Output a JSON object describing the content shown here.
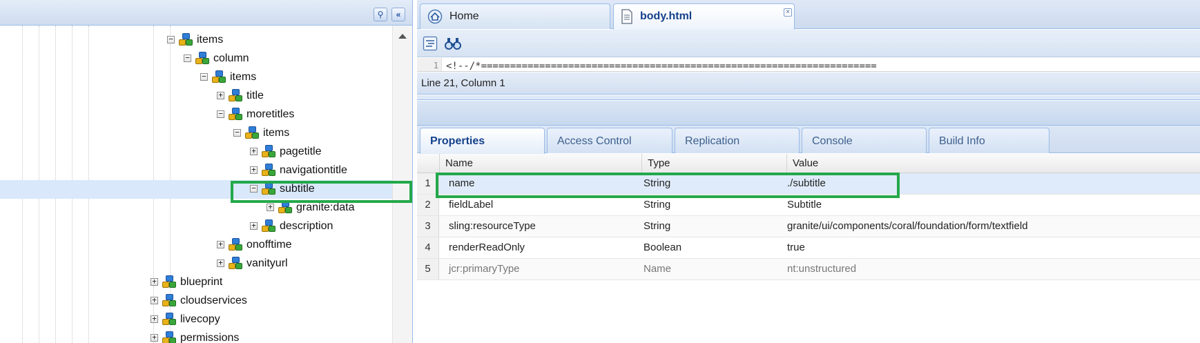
{
  "tree": {
    "rows": [
      {
        "label": "items",
        "toggle": "−"
      },
      {
        "label": "column",
        "toggle": "−"
      },
      {
        "label": "items",
        "toggle": "−"
      },
      {
        "label": "title",
        "toggle": "+"
      },
      {
        "label": "moretitles",
        "toggle": "−"
      },
      {
        "label": "items",
        "toggle": "−"
      },
      {
        "label": "pagetitle",
        "toggle": "+"
      },
      {
        "label": "navigationtitle",
        "toggle": "+"
      },
      {
        "label": "subtitle",
        "toggle": "−"
      },
      {
        "label": "granite:data",
        "toggle": "+"
      },
      {
        "label": "description",
        "toggle": "+"
      },
      {
        "label": "onofftime",
        "toggle": "+"
      },
      {
        "label": "vanityurl",
        "toggle": "+"
      },
      {
        "label": "blueprint",
        "toggle": "+"
      },
      {
        "label": "cloudservices",
        "toggle": "+"
      },
      {
        "label": "livecopy",
        "toggle": "+"
      },
      {
        "label": "permissions",
        "toggle": "+"
      }
    ],
    "selected_label": "subtitle"
  },
  "editor": {
    "tabs": [
      {
        "label": "Home",
        "icon": "home-icon"
      },
      {
        "label": "body.html",
        "icon": "file-icon"
      }
    ],
    "code_line_number": "1",
    "code_line": "<!--/*====================================================================",
    "status": "Line 21, Column 1"
  },
  "properties": {
    "tabs": [
      "Properties",
      "Access Control",
      "Replication",
      "Console",
      "Build Info"
    ],
    "columns": [
      "Name",
      "Type",
      "Value"
    ],
    "rows": [
      {
        "num": "1",
        "name": "name",
        "type": "String",
        "value": "./subtitle"
      },
      {
        "num": "2",
        "name": "fieldLabel",
        "type": "String",
        "value": "Subtitle"
      },
      {
        "num": "3",
        "name": "sling:resourceType",
        "type": "String",
        "value": "granite/ui/components/coral/foundation/form/textfield"
      },
      {
        "num": "4",
        "name": "renderReadOnly",
        "type": "Boolean",
        "value": "true"
      },
      {
        "num": "5",
        "name": "jcr:primaryType",
        "type": "Name",
        "value": "nt:unstructured"
      }
    ]
  },
  "highlight_color": "#23a84a"
}
